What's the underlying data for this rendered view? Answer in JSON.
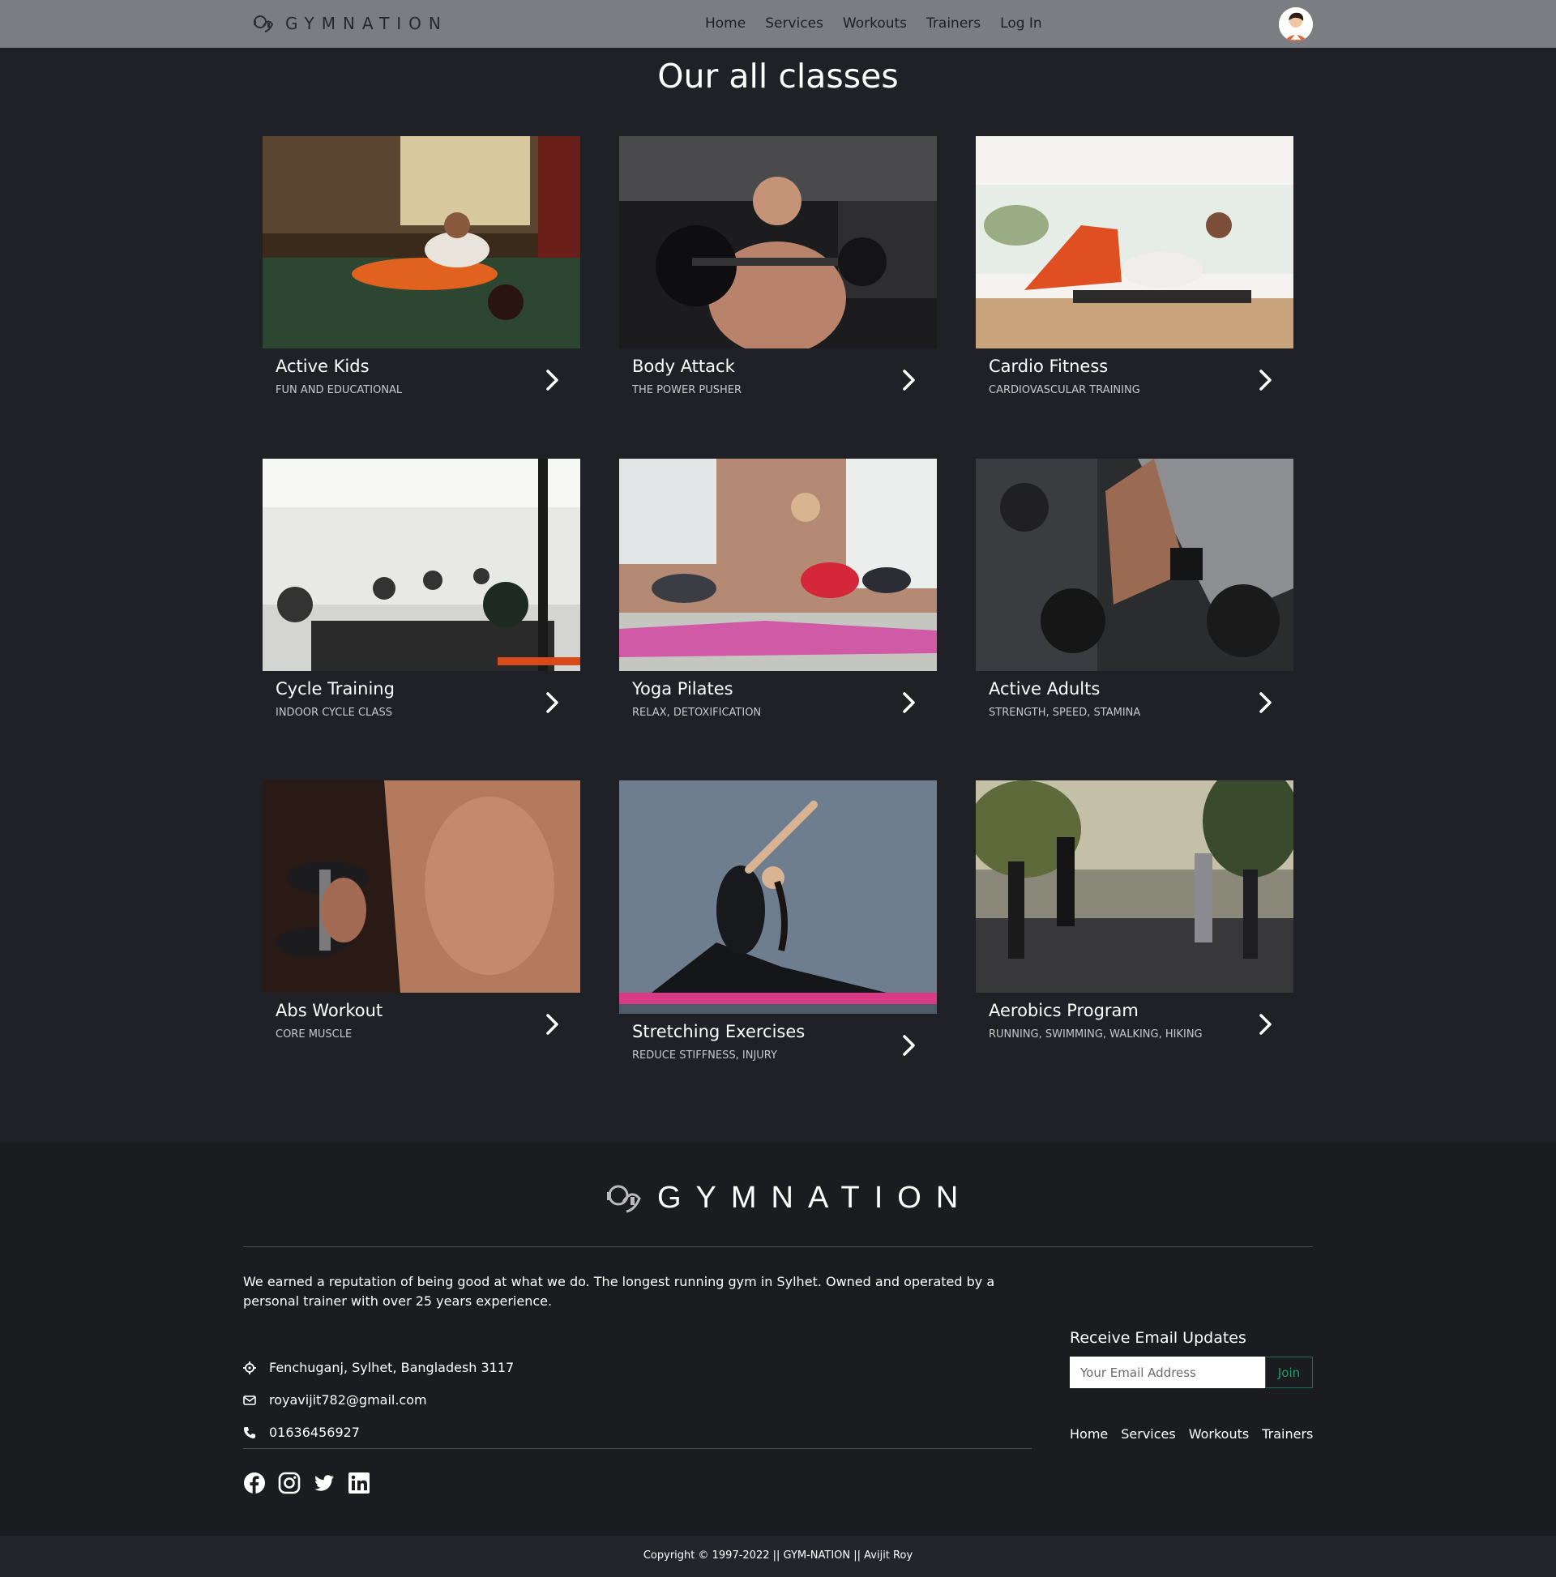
{
  "header": {
    "brand": "GYMNATION",
    "nav": [
      "Home",
      "Services",
      "Workouts",
      "Trainers",
      "Log In"
    ]
  },
  "page_title": "Our all classes",
  "classes": [
    {
      "title": "Active Kids",
      "subtitle": "FUN AND EDUCATIONAL"
    },
    {
      "title": "Body Attack",
      "subtitle": "THE POWER PUSHER"
    },
    {
      "title": "Cardio Fitness",
      "subtitle": "CARDIOVASCULAR TRAINING"
    },
    {
      "title": "Cycle Training",
      "subtitle": "INDOOR CYCLE CLASS"
    },
    {
      "title": "Yoga Pilates",
      "subtitle": "RELAX, DETOXIFICATION"
    },
    {
      "title": "Active Adults",
      "subtitle": "STRENGTH, SPEED, STAMINA"
    },
    {
      "title": "Abs Workout",
      "subtitle": "CORE MUSCLE"
    },
    {
      "title": "Stretching Exercises",
      "subtitle": "REDUCE STIFFNESS, INJURY"
    },
    {
      "title": "Aerobics Program",
      "subtitle": "RUNNING, SWIMMING, WALKING, HIKING"
    }
  ],
  "footer": {
    "brand": "GYMNATION",
    "about": "We earned a reputation of being good at what we do. The longest running gym in Sylhet. Owned and operated by a personal trainer with over 25 years experience.",
    "address": "Fenchuganj, Sylhet, Bangladesh 3117",
    "email": "royavijit782@gmail.com",
    "phone": "01636456927",
    "newsletter_title": "Receive Email Updates",
    "email_placeholder": "Your Email Address",
    "join_label": "Join",
    "nav": [
      "Home",
      "Services",
      "Workouts",
      "Trainers"
    ],
    "socials": [
      "facebook-icon",
      "instagram-icon",
      "twitter-icon",
      "linkedin-icon"
    ],
    "copyright": "Copyright © 1997-2022 || GYM-NATION || Avijit Roy"
  },
  "colors": {
    "navbar_bg": "#7b7d83",
    "page_bg": "#1f2126",
    "footer_bg": "#1b1c1f",
    "accent_green": "#2a9a6d"
  }
}
